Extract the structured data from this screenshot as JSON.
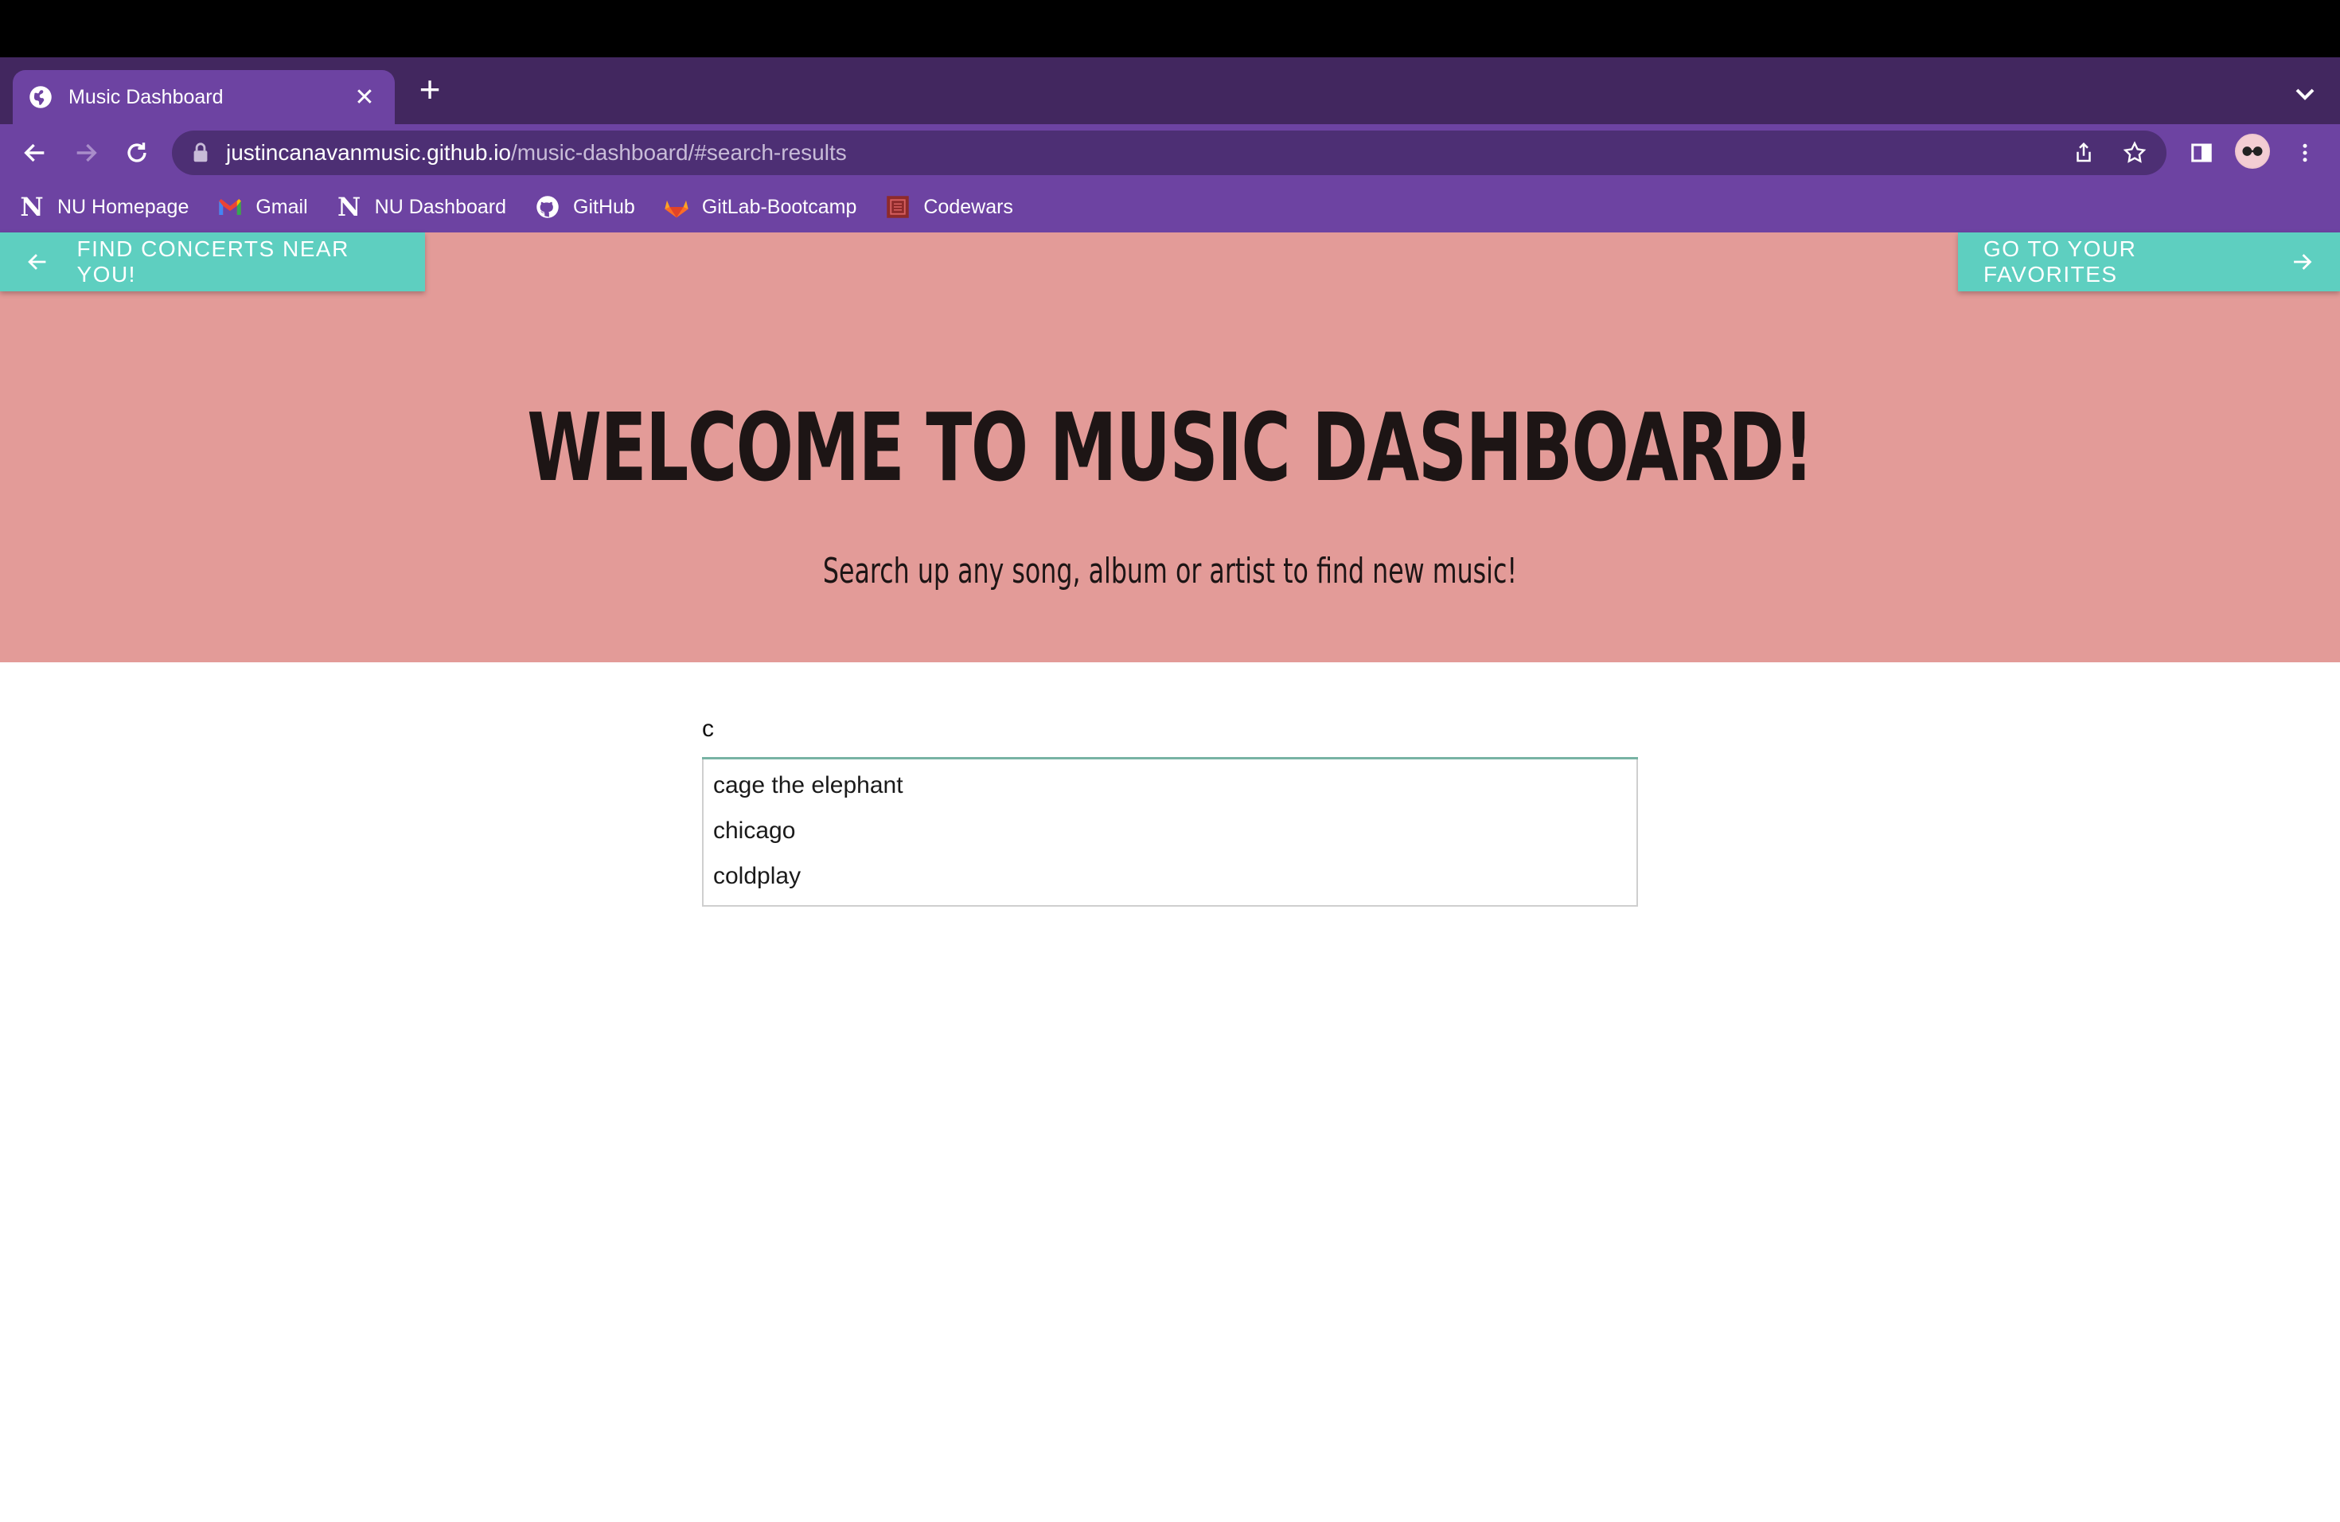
{
  "browser": {
    "tab_title": "Music Dashboard",
    "tab_close": "✕",
    "new_tab": "+",
    "url_host": "justincanavanmusic.github.io",
    "url_path": "/music-dashboard/#search-results",
    "bookmarks": [
      {
        "label": "NU Homepage",
        "icon": "n-logo-icon"
      },
      {
        "label": "Gmail",
        "icon": "gmail-icon"
      },
      {
        "label": "NU Dashboard",
        "icon": "n-logo-icon"
      },
      {
        "label": "GitHub",
        "icon": "github-icon"
      },
      {
        "label": "GitLab-Bootcamp",
        "icon": "gitlab-icon"
      },
      {
        "label": "Codewars",
        "icon": "codewars-icon"
      }
    ]
  },
  "page": {
    "left_button": "FIND CONCERTS NEAR YOU!",
    "right_button": "GO TO YOUR FAVORITES",
    "title": "WELCOME TO MUSIC DASHBOARD!",
    "subtitle": "Search up any song, album or artist to find new music!",
    "search_value": "c",
    "suggestions": [
      "cage the elephant",
      "chicago",
      "coldplay"
    ]
  },
  "colors": {
    "hero_bg": "#e39b98",
    "button_teal": "#5ecfc0",
    "browser_purple": "#6d43a2"
  }
}
